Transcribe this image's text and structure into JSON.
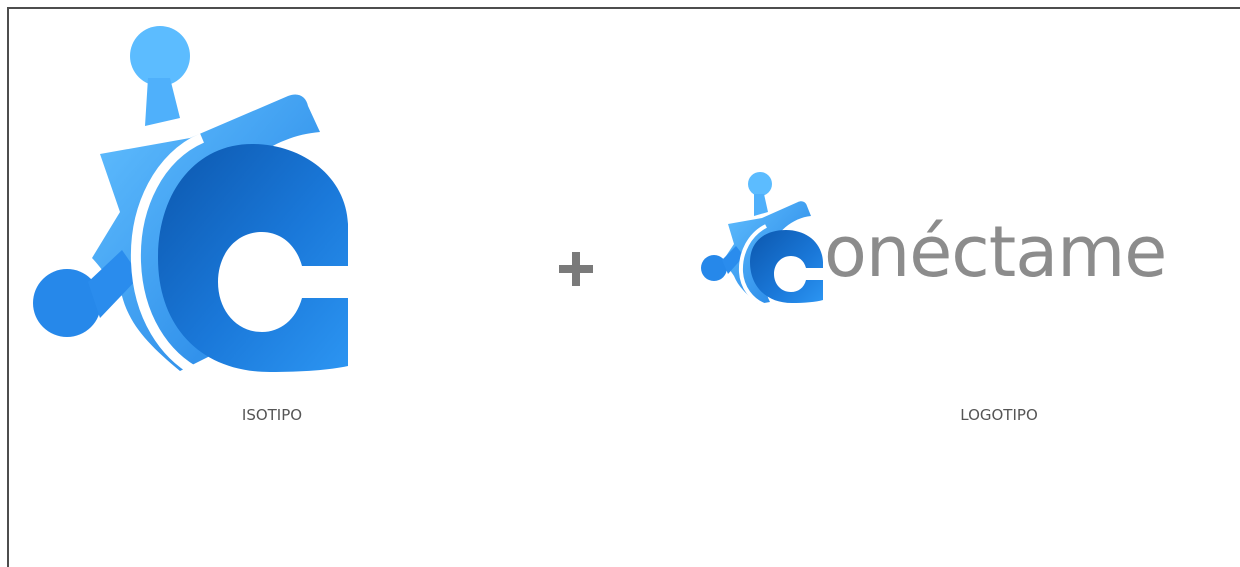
{
  "brand": {
    "wordmark": "onéctame",
    "colors": {
      "blue_light": "#5bb9ff",
      "blue_mid": "#1f86e6",
      "blue_dark": "#0a5fb7",
      "wordmark_gray": "#8c8c8c",
      "plus_gray": "#7a7a7a"
    }
  },
  "captions": {
    "isotipo": "ISOTIPO",
    "logotipo": "LOGOTIPO"
  },
  "icons": {
    "isotipo": "puzzle-c-mark",
    "plus": "plus-icon",
    "logo_mark": "puzzle-c-mark-small"
  }
}
